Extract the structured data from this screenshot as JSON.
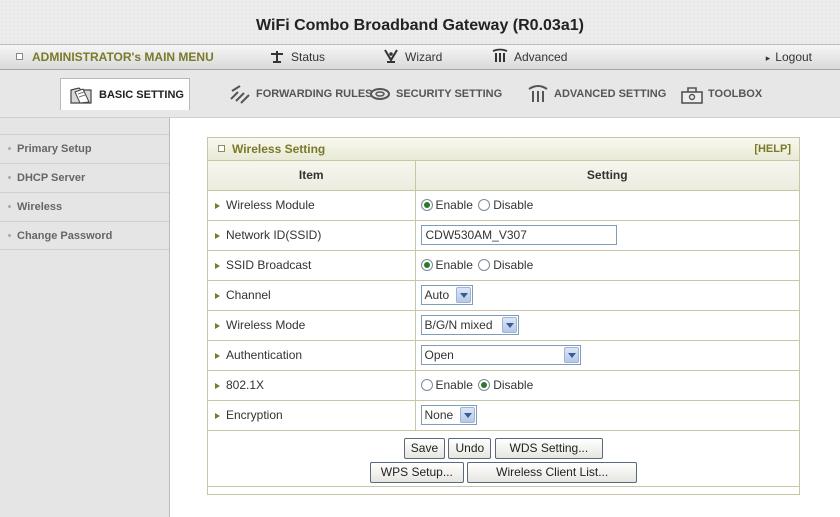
{
  "header": {
    "title": "WiFi Combo Broadband Gateway (R0.03a1)"
  },
  "main_menu": {
    "admin": "ADMINISTRATOR's MAIN MENU",
    "status": "Status",
    "wizard": "Wizard",
    "advanced": "Advanced",
    "logout": "Logout"
  },
  "tabs": {
    "basic": "BASIC SETTING",
    "forwarding": "FORWARDING RULES",
    "security": "SECURITY SETTING",
    "advanced": "ADVANCED SETTING",
    "toolbox": "TOOLBOX"
  },
  "sidebar": {
    "items": [
      {
        "label": "Primary Setup"
      },
      {
        "label": "DHCP Server"
      },
      {
        "label": "Wireless"
      },
      {
        "label": "Change Password"
      }
    ]
  },
  "panel": {
    "title": "Wireless Setting",
    "help": "[HELP]",
    "col_item": "Item",
    "col_setting": "Setting",
    "enable": "Enable",
    "disable": "Disable",
    "rows": {
      "module": {
        "label": "Wireless Module",
        "value": "Enable"
      },
      "ssid": {
        "label": "Network ID(SSID)",
        "value": "CDW530AM_V307"
      },
      "broadcast": {
        "label": "SSID Broadcast",
        "value": "Enable"
      },
      "channel": {
        "label": "Channel",
        "value": "Auto"
      },
      "mode": {
        "label": "Wireless Mode",
        "value": "B/G/N mixed"
      },
      "auth": {
        "label": "Authentication",
        "value": "Open"
      },
      "dot1x": {
        "label": "802.1X",
        "value": "Disable"
      },
      "encryption": {
        "label": "Encryption",
        "value": "None"
      }
    }
  },
  "buttons": {
    "save": "Save",
    "undo": "Undo",
    "wds": "WDS Setting...",
    "wps": "WPS Setup...",
    "client_list": "Wireless Client List..."
  },
  "colors": {
    "accent": "#7a7a2a",
    "border": "#c7c7a7",
    "radio_selected": "#2b7a2b"
  }
}
